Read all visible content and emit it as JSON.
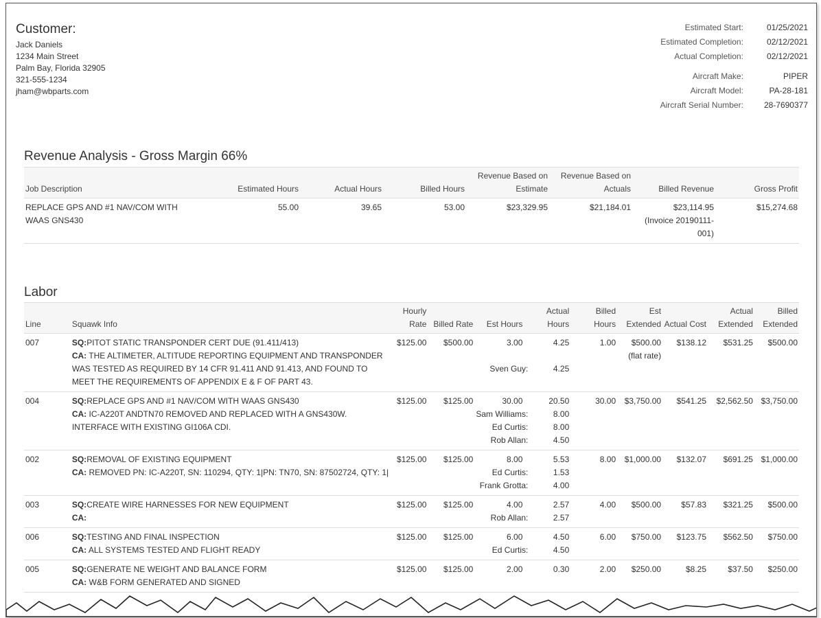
{
  "customer": {
    "heading": "Customer:",
    "name": "Jack Daniels",
    "street": "1234 Main Street",
    "city": "Palm Bay, Florida 32905",
    "phone": "321-555-1234",
    "email": "jham@wbparts.com"
  },
  "dates": {
    "estimated_start_label": "Estimated Start:",
    "estimated_start": "01/25/2021",
    "estimated_completion_label": "Estimated Completion:",
    "estimated_completion": "02/12/2021",
    "actual_completion_label": "Actual Completion:",
    "actual_completion": "02/12/2021",
    "make_label": "Aircraft Make:",
    "make": "PIPER",
    "model_label": "Aircraft Model:",
    "model": "PA-28-181",
    "serial_label": "Aircraft Serial Number:",
    "serial": "28-7690377"
  },
  "revenue": {
    "title": "Revenue Analysis - Gross Margin 66%",
    "headers": {
      "job_description": "Job Description",
      "estimated_hours": "Estimated Hours",
      "actual_hours": "Actual Hours",
      "billed_hours": "Billed Hours",
      "rev_estimate": "Revenue Based on Estimate",
      "rev_actuals": "Revenue Based on Actuals",
      "billed_revenue": "Billed Revenue",
      "gross_profit": "Gross Profit"
    },
    "row": {
      "job_description": "REPLACE GPS AND #1 NAV/COM WITH WAAS GNS430",
      "estimated_hours": "55.00",
      "actual_hours": "39.65",
      "billed_hours": "53.00",
      "rev_estimate": "$23,329.95",
      "rev_actuals": "$21,184.01",
      "billed_revenue": "$23,114.95 (Invoice 20190111-001)",
      "gross_profit": "$15,274.68"
    }
  },
  "labor": {
    "title": "Labor",
    "headers": {
      "line": "Line",
      "squawk": "Squawk Info",
      "hourly_rate": "Hourly Rate",
      "billed_rate": "Billed Rate",
      "est_hours": "Est Hours",
      "actual_hours": "Actual Hours",
      "billed_hours": "Billed Hours",
      "est_extended": "Est Extended",
      "actual_cost": "Actual Cost",
      "actual_extended": "Actual Extended",
      "billed_extended": "Billed Extended"
    },
    "sq_label": "SQ:",
    "ca_label": "CA:",
    "rows": [
      {
        "line": "007",
        "sq": "PITOT STATIC TRANSPONDER CERT DUE (91.411/413)",
        "ca": " THE ALTIMETER, ALTITUDE REPORTING EQUIPMENT AND TRANSPONDER WAS TESTED AS REQUIRED BY 14 CFR 91.411 AND 91.413, AND FOUND TO MEET THE REQUIREMENTS OF APPENDIX E & F OF PART 43.",
        "hourly_rate": "$125.00",
        "billed_rate": "$500.00",
        "est_hours": "3.00",
        "actual_hours": "4.25",
        "techs": [
          {
            "name": "Sven Guy:",
            "hours": "4.25"
          }
        ],
        "billed_hours": "1.00",
        "est_extended": "$500.00",
        "est_note": "(flat rate)",
        "actual_cost": "$138.12",
        "actual_extended": "$531.25",
        "billed_extended": "$500.00"
      },
      {
        "line": "004",
        "sq": "REPLACE GPS AND #1 NAV/COM WITH WAAS GNS430",
        "ca": " IC-A220T ANDTN70 REMOVED AND REPLACED WITH A GNS430W. INTERFACE WITH EXISTING GI106A CDI.",
        "hourly_rate": "$125.00",
        "billed_rate": "$125.00",
        "est_hours": "30.00",
        "actual_hours": "20.50",
        "techs": [
          {
            "name": "Sam Williams:",
            "hours": "8.00"
          },
          {
            "name": "Ed Curtis:",
            "hours": "8.00"
          },
          {
            "name": "Rob Allan:",
            "hours": "4.50"
          }
        ],
        "billed_hours": "30.00",
        "est_extended": "$3,750.00",
        "est_note": "",
        "actual_cost": "$541.25",
        "actual_extended": "$2,562.50",
        "billed_extended": "$3,750.00"
      },
      {
        "line": "002",
        "sq": "REMOVAL OF EXISTING EQUIPMENT",
        "ca": " REMOVED PN: IC-A220T, SN: 110294, QTY: 1|PN: TN70, SN: 87502724, QTY: 1|",
        "hourly_rate": "$125.00",
        "billed_rate": "$125.00",
        "est_hours": "8.00",
        "actual_hours": "5.53",
        "techs": [
          {
            "name": "Ed Curtis:",
            "hours": "1.53"
          },
          {
            "name": "Frank Grotta:",
            "hours": "4.00"
          }
        ],
        "billed_hours": "8.00",
        "est_extended": "$1,000.00",
        "est_note": "",
        "actual_cost": "$132.07",
        "actual_extended": "$691.25",
        "billed_extended": "$1,000.00"
      },
      {
        "line": "003",
        "sq": "CREATE WIRE HARNESSES FOR NEW EQUIPMENT",
        "ca": "",
        "hourly_rate": "$125.00",
        "billed_rate": "$125.00",
        "est_hours": "4.00",
        "actual_hours": "2.57",
        "techs": [
          {
            "name": "Rob Allan:",
            "hours": "2.57"
          }
        ],
        "billed_hours": "4.00",
        "est_extended": "$500.00",
        "est_note": "",
        "actual_cost": "$57.83",
        "actual_extended": "$321.25",
        "billed_extended": "$500.00"
      },
      {
        "line": "006",
        "sq": "TESTING AND FINAL INSPECTION",
        "ca": " ALL SYSTEMS TESTED AND FLIGHT READY",
        "hourly_rate": "$125.00",
        "billed_rate": "$125.00",
        "est_hours": "6.00",
        "actual_hours": "4.50",
        "techs": [
          {
            "name": "Ed Curtis:",
            "hours": "4.50"
          }
        ],
        "billed_hours": "6.00",
        "est_extended": "$750.00",
        "est_note": "",
        "actual_cost": "$123.75",
        "actual_extended": "$562.50",
        "billed_extended": "$750.00"
      },
      {
        "line": "005",
        "sq": "GENERATE NE WEIGHT AND BALANCE FORM",
        "ca": " W&B FORM GENERATED AND SIGNED",
        "hourly_rate": "$125.00",
        "billed_rate": "$125.00",
        "est_hours": "2.00",
        "actual_hours": "0.30",
        "techs": [],
        "billed_hours": "2.00",
        "est_extended": "$250.00",
        "est_note": "",
        "actual_cost": "$8.25",
        "actual_extended": "$37.50",
        "billed_extended": "$250.00"
      }
    ]
  }
}
